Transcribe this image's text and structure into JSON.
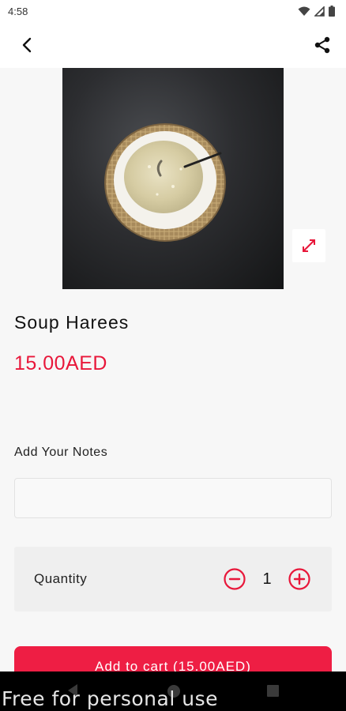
{
  "status_bar": {
    "time": "4:58",
    "icons": [
      "wifi-icon",
      "signal-icon",
      "battery-icon"
    ]
  },
  "app_bar": {
    "back_icon": "back-arrow-icon",
    "share_icon": "share-icon"
  },
  "product": {
    "image_alt": "bowl-of-soup-image",
    "name": "Soup Harees",
    "price": "15.00AED"
  },
  "notes": {
    "label": "Add Your Notes",
    "value": "",
    "placeholder": ""
  },
  "quantity": {
    "label": "Quantity",
    "value": "1"
  },
  "cart": {
    "button_label": "Add to cart (15.00AED)"
  },
  "watermark": {
    "text": "Free for personal use"
  },
  "colors": {
    "accent": "#ee1e44",
    "price": "#e8173a",
    "background": "#f7f7f7"
  }
}
